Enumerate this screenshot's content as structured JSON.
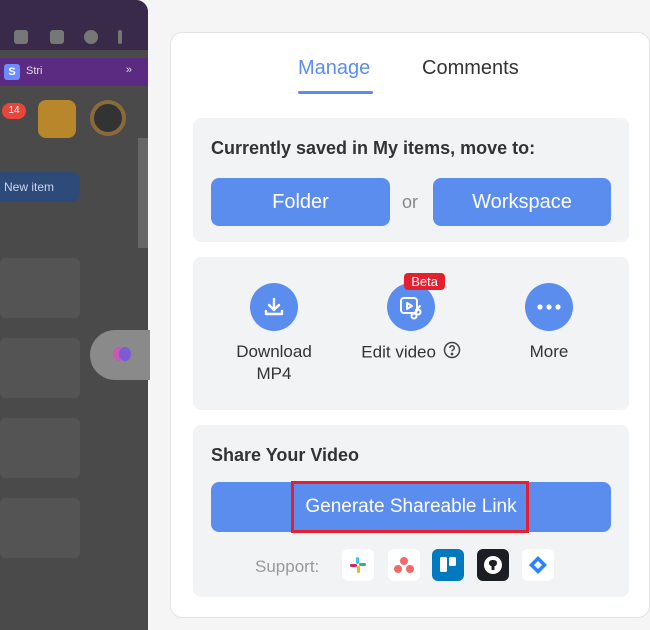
{
  "preview": {
    "tab_label": "Stri",
    "tab_arrows": "»",
    "badge_count": "14",
    "new_item_label": "New item"
  },
  "tabs": [
    {
      "label": "Manage",
      "active": true
    },
    {
      "label": "Comments",
      "active": false
    }
  ],
  "move_section": {
    "title": "Currently saved in My items, move to:",
    "folder_label": "Folder",
    "or_label": "or",
    "workspace_label": "Workspace"
  },
  "actions": [
    {
      "label_line1": "Download",
      "label_line2": "MP4",
      "icon": "download-icon"
    },
    {
      "label_line1": "Edit video",
      "label_line2": "",
      "icon": "edit-video-icon",
      "badge": "Beta",
      "help_icon": "help-circle-icon"
    },
    {
      "label_line1": "More",
      "label_line2": "",
      "icon": "more-dots-icon"
    }
  ],
  "share_section": {
    "title": "Share Your Video",
    "generate_label": "Generate Shareable Link",
    "support_label": "Support:",
    "integrations": [
      "slack-icon",
      "asana-icon",
      "trello-icon",
      "github-icon",
      "jira-icon"
    ]
  },
  "colors": {
    "accent": "#5b8def",
    "beta": "#e5202e",
    "highlight": "#e5202e"
  }
}
